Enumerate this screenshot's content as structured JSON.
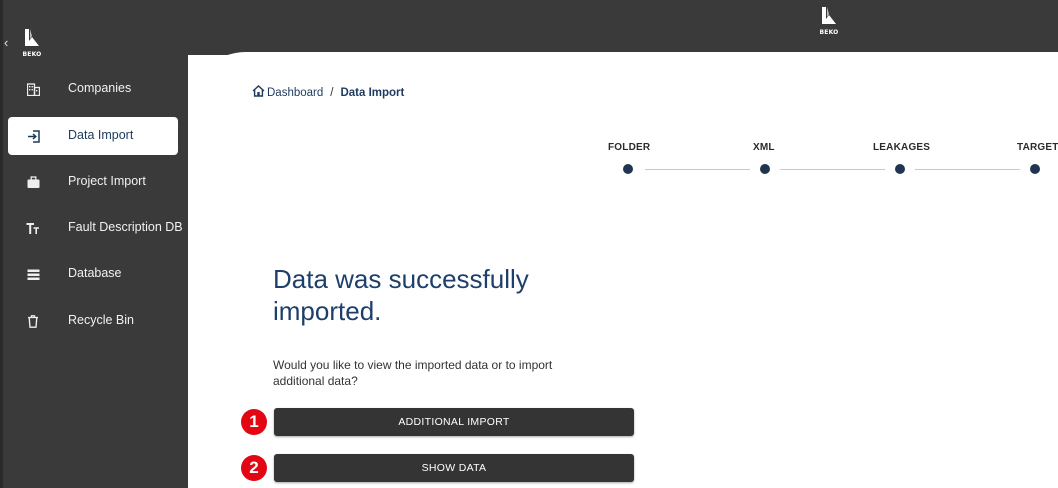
{
  "brand": {
    "logo_text": "BEKO"
  },
  "sidebar": {
    "collapse_glyph": "‹",
    "items": [
      {
        "label": "Companies",
        "icon": "building-icon",
        "active": false
      },
      {
        "label": "Data Import",
        "icon": "login-arrow-icon",
        "active": true
      },
      {
        "label": "Project Import",
        "icon": "briefcase-icon",
        "active": false
      },
      {
        "label": "Fault Description DB",
        "icon": "text-size-icon",
        "active": false
      },
      {
        "label": "Database",
        "icon": "list-icon",
        "active": false
      },
      {
        "label": "Recycle Bin",
        "icon": "trash-icon",
        "active": false
      }
    ]
  },
  "breadcrumb": {
    "home_label": "Dashboard",
    "separator": "/",
    "current": "Data Import"
  },
  "stepper": {
    "steps": [
      "FOLDER",
      "XML",
      "LEAKAGES",
      "TARGET"
    ]
  },
  "content": {
    "headline": "Data was successfully imported.",
    "prompt": "Would you like to view the imported data or to import additional data?",
    "additional_import_label": "ADDITIONAL IMPORT",
    "show_data_label": "SHOW DATA",
    "marker_1": "1",
    "marker_2": "2"
  },
  "colors": {
    "sidebar_bg": "#3a3a3a",
    "accent_navy": "#1e3f6b",
    "step_dot": "#1f3550",
    "button_bg": "#343434",
    "marker_red": "#e30613"
  }
}
